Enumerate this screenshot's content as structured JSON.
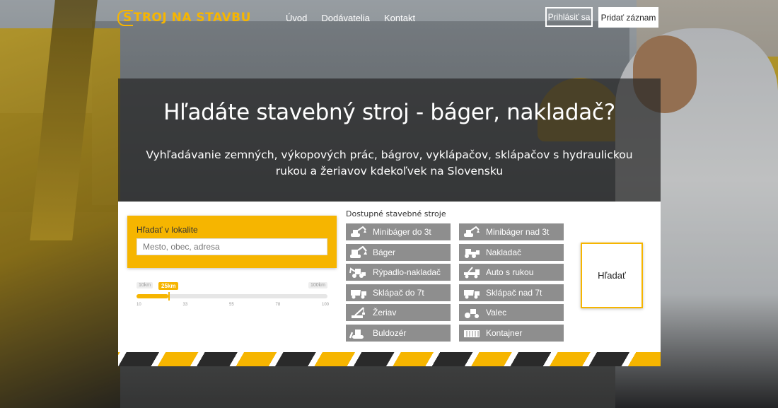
{
  "brand": {
    "logo_text": "STROJ NA STAVBU",
    "accent_color": "#f6b500"
  },
  "nav": {
    "items": [
      "Úvod",
      "Dodávatelia",
      "Kontakt"
    ]
  },
  "header_buttons": {
    "login": "Prihlásiť sa",
    "add": "Pridať záznam"
  },
  "hero": {
    "title": "Hľadáte stavebný stroj - báger, nakladač?",
    "subtitle": "Vyhľadávanie zemných, výkopových prác, bágrov, vyklápačov, sklápačov s hydraulickou rukou a žeriavov kdekoľvek na Slovensku"
  },
  "search": {
    "location_label": "Hľadať v lokalite",
    "location_placeholder": "Mesto, obec, adresa",
    "radius": {
      "min_label": "10km",
      "max_label": "100km",
      "current_label": "25km",
      "value_km": 25,
      "min_km": 10,
      "max_km": 100,
      "ticks": [
        "10",
        "33",
        "55",
        "78",
        "100"
      ]
    },
    "available_title": "Dostupné stavebné stroje",
    "machines": [
      {
        "label": "Minibáger do 3t",
        "icon": "mini-excavator-icon"
      },
      {
        "label": "Minibáger nad 3t",
        "icon": "mini-excavator-icon"
      },
      {
        "label": "Báger",
        "icon": "excavator-icon"
      },
      {
        "label": "Nakladač",
        "icon": "loader-icon"
      },
      {
        "label": "Rýpadlo-nakladač",
        "icon": "backhoe-loader-icon"
      },
      {
        "label": "Auto s rukou",
        "icon": "crane-truck-icon"
      },
      {
        "label": "Sklápač do 7t",
        "icon": "dump-truck-icon"
      },
      {
        "label": "Sklápač nad 7t",
        "icon": "dump-truck-icon"
      },
      {
        "label": "Žeriav",
        "icon": "crane-icon"
      },
      {
        "label": "Valec",
        "icon": "roller-icon"
      },
      {
        "label": "Buldozér",
        "icon": "bulldozer-icon"
      },
      {
        "label": "Kontajner",
        "icon": "container-icon"
      }
    ],
    "submit_label": "Hľadať"
  }
}
